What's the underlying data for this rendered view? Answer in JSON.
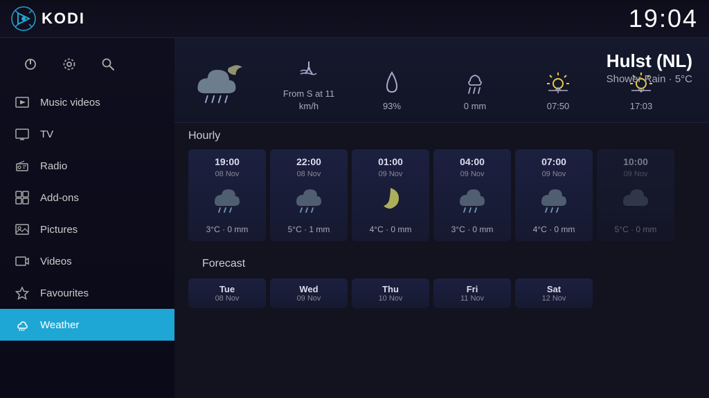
{
  "header": {
    "title": "KODI",
    "clock": "19:04"
  },
  "sidebar": {
    "top_icons": [
      {
        "name": "power-icon",
        "symbol": "⏻"
      },
      {
        "name": "settings-icon",
        "symbol": "⚙"
      },
      {
        "name": "search-icon",
        "symbol": "🔍"
      }
    ],
    "items": [
      {
        "label": "Music videos",
        "icon": "♫",
        "name": "music-videos",
        "active": false
      },
      {
        "label": "TV",
        "icon": "📺",
        "name": "tv",
        "active": false
      },
      {
        "label": "Radio",
        "icon": "📻",
        "name": "radio",
        "active": false
      },
      {
        "label": "Add-ons",
        "icon": "◈",
        "name": "addons",
        "active": false
      },
      {
        "label": "Pictures",
        "icon": "🖼",
        "name": "pictures",
        "active": false
      },
      {
        "label": "Videos",
        "icon": "🎬",
        "name": "videos",
        "active": false
      },
      {
        "label": "Favourites",
        "icon": "★",
        "name": "favourites",
        "active": false
      },
      {
        "label": "Weather",
        "icon": "☁",
        "name": "weather",
        "active": true
      }
    ]
  },
  "current_weather": {
    "location": "Hulst (NL)",
    "condition": "Shower Rain · 5°C",
    "wind": {
      "label": "From S at 11\nkm/h",
      "icon": "wind"
    },
    "humidity": {
      "label": "93%",
      "icon": "humidity"
    },
    "precipitation": {
      "label": "0 mm",
      "icon": "rain"
    },
    "sunrise": {
      "label": "07:50",
      "icon": "sunrise"
    },
    "sunset": {
      "label": "17:03",
      "icon": "sunset"
    }
  },
  "hourly": {
    "label": "Hourly",
    "cards": [
      {
        "time": "19:00",
        "date": "08 Nov",
        "temp": "3°C · 0 mm",
        "type": "cloud-rain"
      },
      {
        "time": "22:00",
        "date": "08 Nov",
        "temp": "5°C · 1 mm",
        "type": "cloud"
      },
      {
        "time": "01:00",
        "date": "09 Nov",
        "temp": "4°C · 0 mm",
        "type": "moon"
      },
      {
        "time": "04:00",
        "date": "09 Nov",
        "temp": "3°C · 0 mm",
        "type": "cloud-rain"
      },
      {
        "time": "07:00",
        "date": "09 Nov",
        "temp": "4°C · 0 mm",
        "type": "cloud-rain"
      },
      {
        "time": "10:00",
        "date": "09 Nov",
        "temp": "5°C · 0 mm",
        "type": "cloud"
      }
    ]
  },
  "forecast": {
    "label": "Forecast",
    "cards": [
      {
        "day": "Tue",
        "date": "08 Nov"
      },
      {
        "day": "Wed",
        "date": "09 Nov"
      },
      {
        "day": "Thu",
        "date": "10 Nov"
      },
      {
        "day": "Fri",
        "date": "11 Nov"
      },
      {
        "day": "Sat",
        "date": "12 Nov"
      }
    ]
  }
}
